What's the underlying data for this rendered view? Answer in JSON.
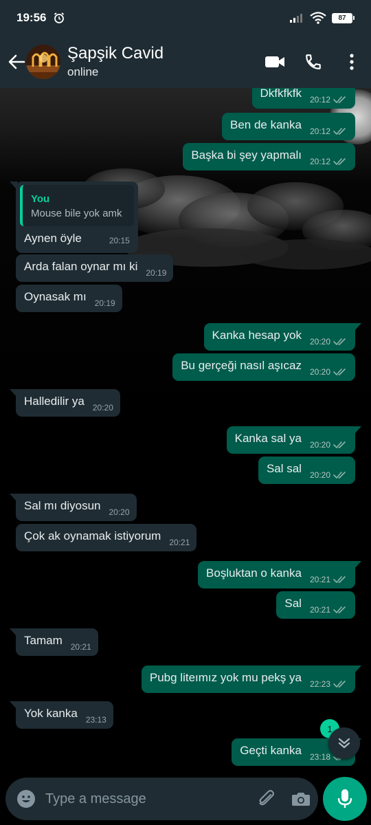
{
  "status_bar": {
    "time": "19:56",
    "battery": "87"
  },
  "header": {
    "name": "Şapşik Cavid",
    "status": "online"
  },
  "messages": [
    {
      "dir": "out",
      "text": "Dkfkfkfk",
      "time": "20:12"
    },
    {
      "dir": "out",
      "text": "Ben de kanka",
      "time": "20:12"
    },
    {
      "dir": "out",
      "text": "Başka bi şey yapmalı",
      "time": "20:12"
    },
    {
      "dir": "in",
      "quote_author": "You",
      "quote_text": "Mouse bile yok amk",
      "text": "Aynen öyle",
      "time": "20:15"
    },
    {
      "dir": "in",
      "text": "Arda falan oynar mı ki",
      "time": "20:19"
    },
    {
      "dir": "in",
      "text": "Oynasak mı",
      "time": "20:19"
    },
    {
      "dir": "out",
      "text": "Kanka hesap yok",
      "time": "20:20"
    },
    {
      "dir": "out",
      "text": "Bu gerçeği nasıl aşıcaz",
      "time": "20:20"
    },
    {
      "dir": "in",
      "text": "Halledilir ya",
      "time": "20:20"
    },
    {
      "dir": "out",
      "text": "Kanka sal ya",
      "time": "20:20"
    },
    {
      "dir": "out",
      "text": "Sal sal",
      "time": "20:20"
    },
    {
      "dir": "in",
      "text": "Sal mı diyosun",
      "time": "20:20"
    },
    {
      "dir": "in",
      "text": "Çok ak oynamak istiyorum",
      "time": "20:21"
    },
    {
      "dir": "out",
      "text": "Boşluktan o kanka",
      "time": "20:21"
    },
    {
      "dir": "out",
      "text": "Sal",
      "time": "20:21"
    },
    {
      "dir": "in",
      "text": "Tamam",
      "time": "20:21"
    },
    {
      "dir": "out",
      "text": "Pubg liteımız yok mu pekş ya",
      "time": "22:23"
    },
    {
      "dir": "in",
      "text": "Yok kanka",
      "time": "23:13"
    },
    {
      "dir": "out",
      "text": "Geçti kanka",
      "time": "23:18"
    }
  ],
  "unread_count": "1",
  "composer": {
    "placeholder": "Type a message"
  },
  "colors": {
    "outgoing": "#005c4b",
    "incoming": "#1f2c33",
    "accent": "#00a884"
  },
  "icons": [
    "back-arrow-icon",
    "video-call-icon",
    "phone-icon",
    "more-vert-icon",
    "emoji-icon",
    "attach-icon",
    "camera-icon",
    "mic-icon",
    "double-chevron-down-icon"
  ]
}
